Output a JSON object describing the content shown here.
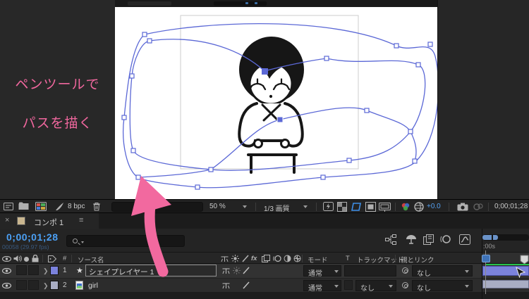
{
  "annotation": {
    "line1": "ペンツールで",
    "line2": "パスを描く",
    "pink": "#f0679e"
  },
  "viewer_toolbar": {
    "bit_depth": "8 bpc",
    "zoom_value": "50 %",
    "quality_value": "1/3 画質",
    "exposure_value": "+0.0",
    "timecode": "0;00;01;28"
  },
  "timeline": {
    "tab": {
      "close_label": "×",
      "title": "コンポ 1",
      "menu_label": "≡"
    },
    "current_timecode": "0;00;01;28",
    "frame_info": "00058 (29.97 fps)",
    "ruler_label": ":00s",
    "columns": {
      "index": "#",
      "source": "ソース名",
      "mode": "モード",
      "t_switch": "T",
      "track_matte": "トラックマット",
      "parent_link": "親とリンク"
    },
    "switch_labels": {
      "fx": "fx"
    },
    "layers": [
      {
        "index": "1",
        "name": "シェイプレイヤー 1",
        "mode": "通常",
        "parent": "なし"
      },
      {
        "index": "2",
        "name": "girl",
        "mode": "通常",
        "track_matte": "なし",
        "parent": "なし"
      }
    ]
  },
  "colors": {
    "accent_blue": "#4ba0f5",
    "path_blue": "#5b68d6",
    "layer1_bar": "#7b82dc",
    "layer2_bar": "#a9adc4",
    "render_green": "#27c24c",
    "annotation_pink": "#f0679e"
  }
}
